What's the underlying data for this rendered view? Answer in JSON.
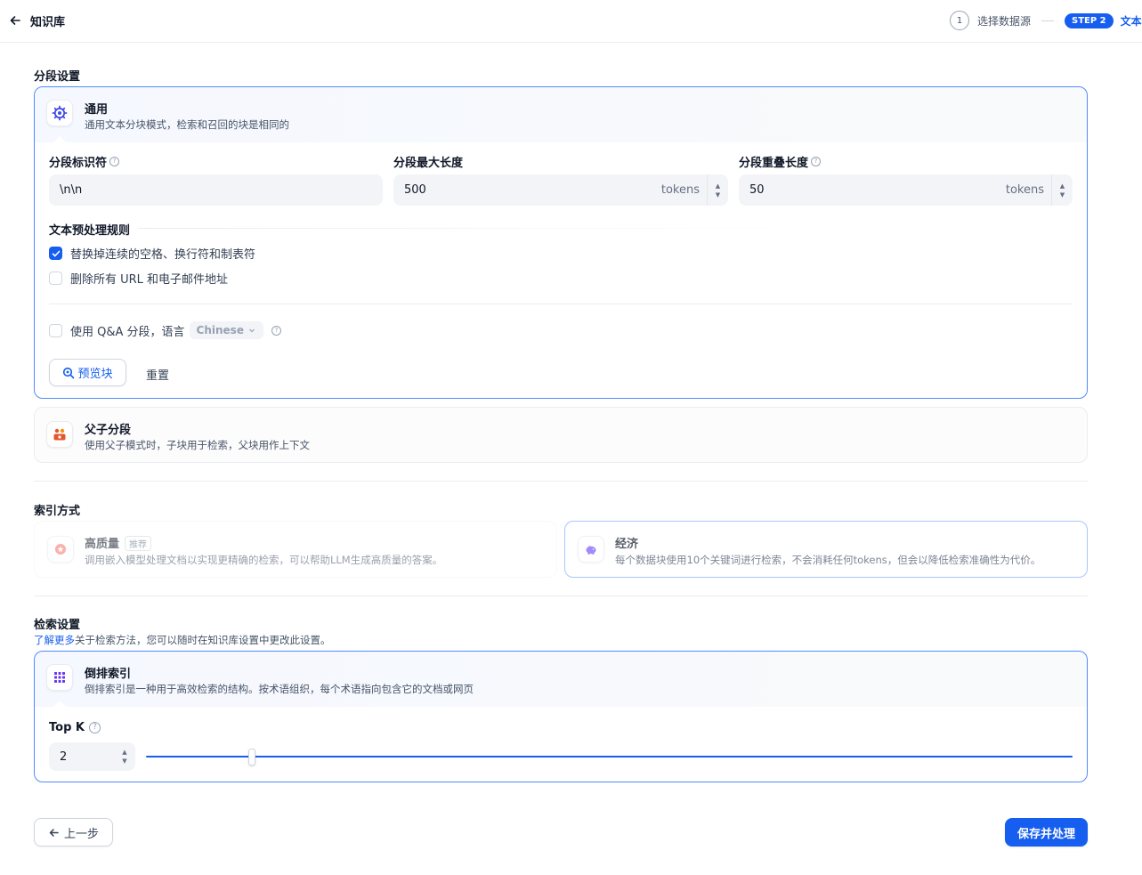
{
  "header": {
    "title": "知识库",
    "back_icon": "arrow-left-icon",
    "steps": [
      {
        "number": "1",
        "label": "选择数据源"
      },
      {
        "badge": "STEP 2",
        "label": "文本分段与清洗"
      }
    ]
  },
  "segmentation": {
    "section_title": "分段设置",
    "general": {
      "title": "通用",
      "description": "通用文本分块模式，检索和召回的块是相同的",
      "delimiter_label": "分段标识符",
      "delimiter_value": "\\n\\n",
      "max_length_label": "分段最大长度",
      "max_length_value": "500",
      "overlap_label": "分段重叠长度",
      "overlap_value": "50",
      "unit": "tokens",
      "rules_title": "文本预处理规则",
      "rules": [
        {
          "label": "替换掉连续的空格、换行符和制表符",
          "checked": true
        },
        {
          "label": "删除所有 URL 和电子邮件地址",
          "checked": false
        }
      ],
      "qa_label": "使用 Q&A 分段，语言",
      "qa_checked": false,
      "qa_language": "Chinese",
      "preview_button": "预览块",
      "reset_button": "重置"
    },
    "parent_child": {
      "title": "父子分段",
      "description": "使用父子模式时，子块用于检索，父块用作上下文"
    }
  },
  "index": {
    "section_title": "索引方式",
    "high_quality": {
      "title": "高质量",
      "tag": "推荐",
      "description": "调用嵌入模型处理文档以实现更精确的检索，可以帮助LLM生成高质量的答案。"
    },
    "economy": {
      "title": "经济",
      "description": "每个数据块使用10个关键词进行检索，不会消耗任何tokens，但会以降低检索准确性为代价。"
    }
  },
  "retrieval": {
    "section_title": "检索设置",
    "learn_more": "了解更多",
    "description_rest": "关于检索方法，您可以随时在知识库设置中更改此设置。",
    "inverted": {
      "title": "倒排索引",
      "description": "倒排索引是一种用于高效检索的结构。按术语组织，每个术语指向包含它的文档或网页"
    },
    "topk_label": "Top K",
    "topk_value": "2"
  },
  "footer": {
    "prev_button": "上一步",
    "save_button": "保存并处理"
  },
  "colors": {
    "primary": "#155eef",
    "border_active": "#528bff"
  }
}
